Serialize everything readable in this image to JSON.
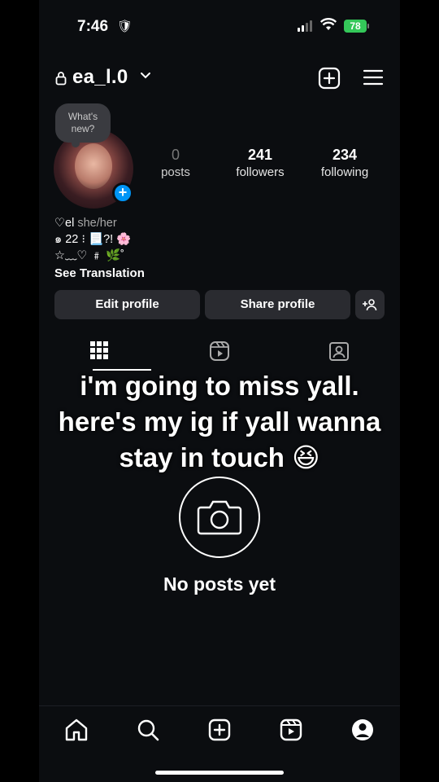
{
  "status_bar": {
    "time": "7:46",
    "glyph": "🛡",
    "battery": "78"
  },
  "header": {
    "username": "ea_l.0"
  },
  "profile": {
    "note": "What's new?",
    "stats": [
      {
        "value": "0",
        "label": "posts"
      },
      {
        "value": "241",
        "label": "followers"
      },
      {
        "value": "234",
        "label": "following"
      }
    ],
    "bio": {
      "name": "♡el",
      "pronouns": "she/her",
      "line2": "๑ 22 ⁝ 📃?! 🌸",
      "line3": "☆﹏♡ ﹟ 🌿˚",
      "see_translation": "See Translation"
    }
  },
  "buttons": {
    "edit": "Edit profile",
    "share": "Share profile"
  },
  "caption": [
    "i'm going to miss yall.",
    "here's my ig if yall wanna",
    "stay in touch 😆"
  ],
  "empty_state": {
    "text": "No posts yet"
  },
  "icons": {
    "lock": "lock-icon",
    "chevron": "chevron-down-icon",
    "add": "add-square-icon",
    "menu": "hamburger-icon",
    "grid": "grid-icon",
    "reels": "reels-icon",
    "tagged": "tagged-icon",
    "camera": "camera-icon",
    "home": "home-icon",
    "search": "search-icon",
    "create": "create-icon",
    "profile": "profile-icon",
    "add_person": "add-person-icon"
  },
  "colors": {
    "background": "#0b0d10",
    "button": "#2a2b30",
    "accent": "#0095f6",
    "battery": "#34c759"
  }
}
